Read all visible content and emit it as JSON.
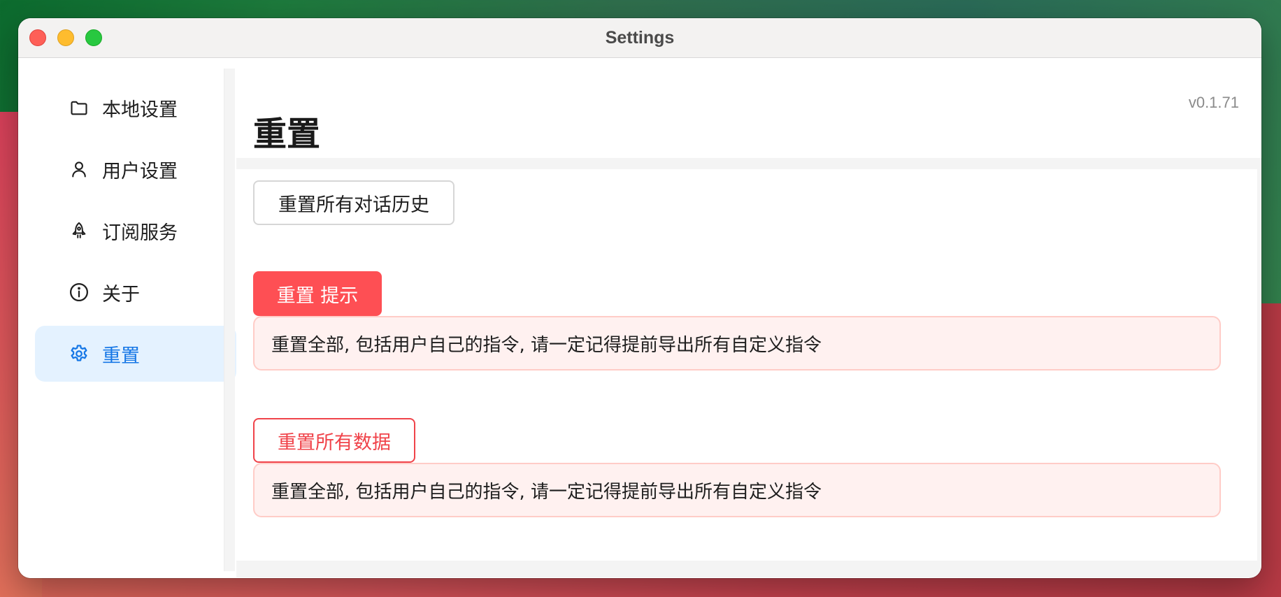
{
  "window": {
    "title": "Settings"
  },
  "sidebar": {
    "items": [
      {
        "label": "本地设置",
        "icon": "folder-icon",
        "active": false
      },
      {
        "label": "用户设置",
        "icon": "user-icon",
        "active": false
      },
      {
        "label": "订阅服务",
        "icon": "rocket-icon",
        "active": false
      },
      {
        "label": "关于",
        "icon": "info-icon",
        "active": false
      },
      {
        "label": "重置",
        "icon": "gear-icon",
        "active": true
      }
    ]
  },
  "main": {
    "version": "v0.1.71",
    "title": "重置",
    "reset_history_label": "重置所有对话历史",
    "reset_tip_label": "重置 提示",
    "tip_message": "重置全部, 包括用户自己的指令, 请一定记得提前导出所有自定义指令",
    "reset_all_label": "重置所有数据",
    "all_message": "重置全部, 包括用户自己的指令, 请一定记得提前导出所有自定义指令"
  },
  "colors": {
    "accent": "#1677e6",
    "active_bg": "#e4f2ff",
    "danger": "#fe4f54",
    "alert_bg": "#fff1f0",
    "alert_border": "#ffccc7"
  }
}
